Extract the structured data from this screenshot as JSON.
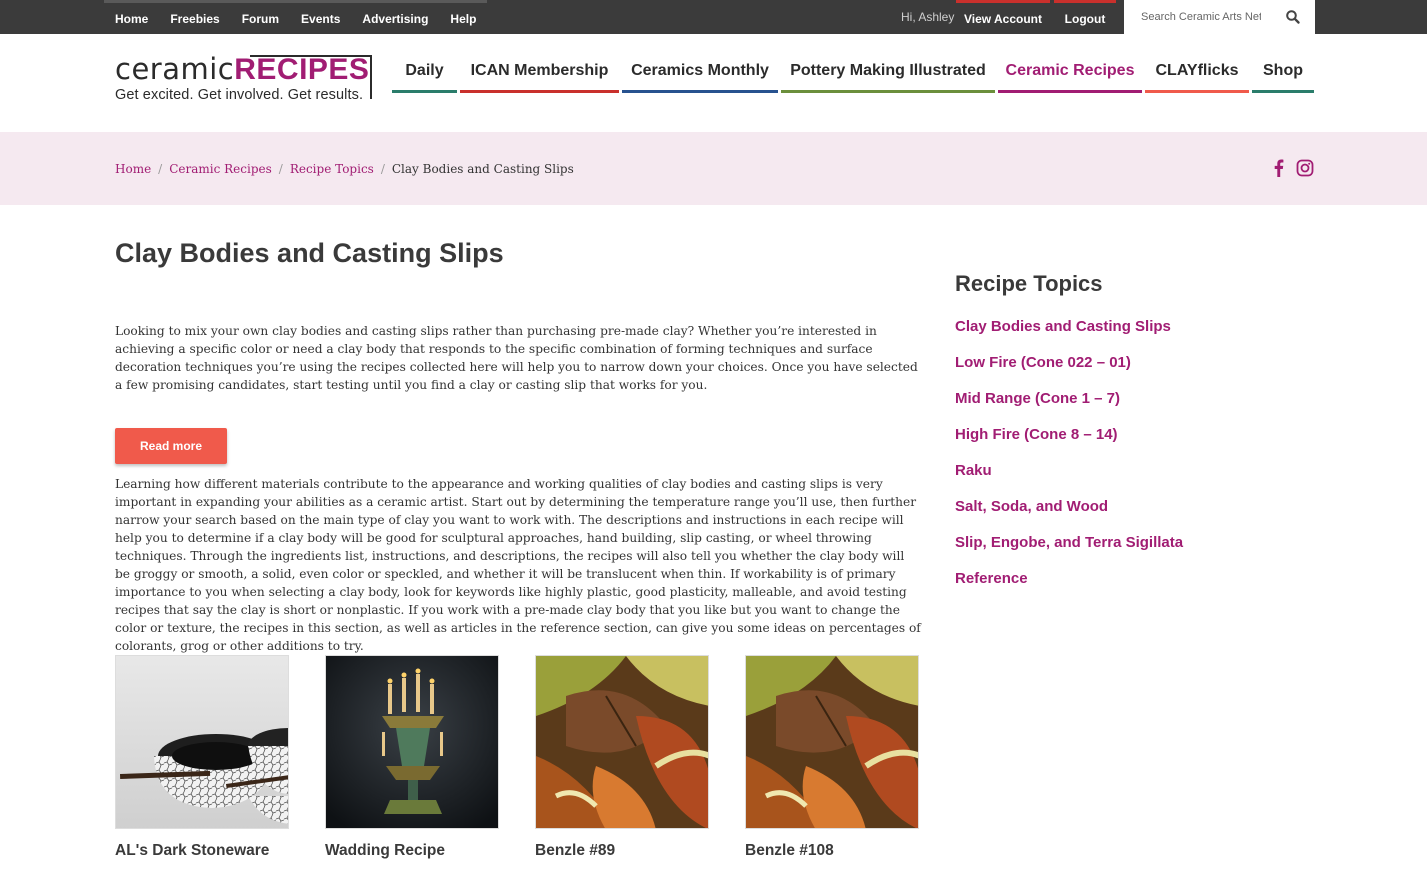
{
  "topbar": {
    "links": [
      "Home",
      "Freebies",
      "Forum",
      "Events",
      "Advertising",
      "Help"
    ],
    "greeting": "Hi, Ashley",
    "view_account": "View Account",
    "logout": "Logout",
    "search_placeholder": "Search Ceramic Arts Network",
    "bar_color": "#3b3b3b",
    "button_color": "#3b3b3b"
  },
  "logo": {
    "word1": "ceramic",
    "word2": "RECIPES",
    "tagline": "Get excited. Get involved. Get results."
  },
  "nav": {
    "items": [
      {
        "label": "Daily",
        "color": "#2a7d6b",
        "text_color": "#2b2b2b"
      },
      {
        "label": "ICAN Membership",
        "color": "#c9302c",
        "text_color": "#2b2b2b"
      },
      {
        "label": "Ceramics Monthly",
        "color": "#27528f",
        "text_color": "#2b2b2b"
      },
      {
        "label": "Pottery Making Illustrated",
        "color": "#6b8f3c",
        "text_color": "#2b2b2b"
      },
      {
        "label": "Ceramic Recipes",
        "color": "#a11d73",
        "text_color": "#a11d73"
      },
      {
        "label": "CLAYflicks",
        "color": "#f05a4b",
        "text_color": "#2b2b2b"
      },
      {
        "label": "Shop",
        "color": "#2a7d6b",
        "text_color": "#2b2b2b"
      }
    ]
  },
  "breadcrumb": {
    "items": [
      "Home",
      "Ceramic Recipes",
      "Recipe Topics"
    ],
    "current": "Clay Bodies and Casting Slips"
  },
  "social": {
    "icons": [
      "facebook-icon",
      "instagram-icon"
    ],
    "color": "#a11d73"
  },
  "main": {
    "title": "Clay Bodies and Casting Slips",
    "intro": "Looking to mix your own clay bodies and casting slips rather than purchasing pre-made clay? Whether you’re interested in achieving a specific color or need a clay body that responds to the specific combination of forming techniques and surface decoration techniques you’re using the recipes collected here will help you to narrow down your choices. Once you have selected a few promising candidates, start testing until you find a clay or casting slip that works for you.",
    "read_more": "Read more",
    "body": "Learning how different materials contribute to the appearance and working qualities of clay bodies and casting slips is very important in expanding your abilities as a ceramic artist. Start out by determining the temperature range you’ll use, then further narrow your search based on the main type of clay you want to work with. The descriptions and instructions in each recipe will help you to determine if a clay body will be good for sculptural approaches, hand building, slip casting, or wheel throwing techniques. Through the ingredients list, instructions, and descriptions, the recipes will also tell you whether the clay body will be groggy or smooth, a solid, even color or speckled, and whether it will be translucent when thin. If workability is of primary importance to you when selecting a clay body, look for keywords like highly plastic, good plasticity, malleable, and avoid testing recipes that say the clay is short or nonplastic. If you work with a pre-made clay body that you like but you want to change the color or texture, the recipes in this section, as well as articles in the reference section, can give you some ideas on percentages of colorants, grog or other additions to try.",
    "cards": [
      {
        "title": "AL's Dark Stoneware"
      },
      {
        "title": "Wadding Recipe"
      },
      {
        "title": "Benzle #89"
      },
      {
        "title": "Benzle #108"
      }
    ]
  },
  "sidebar": {
    "title": "Recipe Topics",
    "topics": [
      "Clay Bodies and Casting Slips",
      "Low Fire (Cone 022 – 01)",
      "Mid Range (Cone 1 – 7)",
      "High Fire (Cone 8 – 14)",
      "Raku",
      "Salt, Soda, and Wood",
      "Slip, Engobe, and Terra Sigillata",
      "Reference"
    ]
  },
  "colors": {
    "accent": "#a11d73",
    "button": "#f05a4b",
    "crumb_band": "#f5e9f0"
  }
}
